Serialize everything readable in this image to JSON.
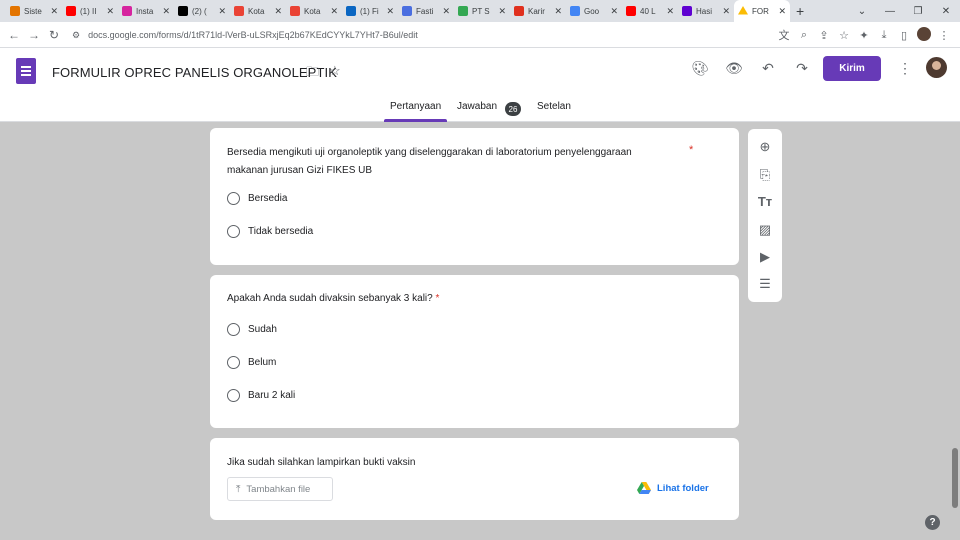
{
  "browser": {
    "tabs": [
      {
        "label": "Siste",
        "color": "#e37400"
      },
      {
        "label": "(1) II",
        "color": "#ff0000"
      },
      {
        "label": "Insta",
        "color": "#d6249f"
      },
      {
        "label": "(2) (",
        "color": "#000000"
      },
      {
        "label": "Kota",
        "color": "#ea4335"
      },
      {
        "label": "Kota",
        "color": "#ea4335"
      },
      {
        "label": "(1) Fi",
        "color": "#0a66c2"
      },
      {
        "label": "Fasti",
        "color": "#4a6ee0"
      },
      {
        "label": "PT S",
        "color": "#34a853"
      },
      {
        "label": "Karir",
        "color": "#e0301e"
      },
      {
        "label": "Goo",
        "color": "#4285f4"
      },
      {
        "label": "40 L",
        "color": "#ff0000"
      },
      {
        "label": "Hasi",
        "color": "#5f01d1"
      },
      {
        "label": "FOR",
        "color": "#fbbc04",
        "active": true
      }
    ],
    "new_tab": "+",
    "url": "docs.google.com/forms/d/1tR71ld-lVerB-uLSRxjEq2b67KEdCYYkL7YHt7-B6ul/edit"
  },
  "header": {
    "title": "FORMULIR OPREC PANELIS ORGANOLEPTIK",
    "send_label": "Kirim",
    "tabs": {
      "questions": "Pertanyaan",
      "responses": "Jawaban",
      "responses_count": "26",
      "settings": "Setelan"
    }
  },
  "questions": [
    {
      "text_line1": "Bersedia mengikuti uji organoleptik yang diselenggarakan di laboratorium penyelenggaraan",
      "text_line2": "makanan jurusan Gizi FIKES UB",
      "required_mark": "*",
      "options": [
        "Bersedia",
        "Tidak bersedia"
      ]
    },
    {
      "text": "Apakah Anda sudah divaksin sebanyak 3 kali?",
      "required_mark": "*",
      "options": [
        "Sudah",
        "Belum",
        "Baru 2 kali"
      ]
    },
    {
      "text": "Jika sudah silahkan lampirkan bukti vaksin",
      "upload_label": "Tambahkan file",
      "folder_link": "Lihat folder"
    }
  ],
  "toolbar": [
    "add-question",
    "import-questions",
    "add-title",
    "add-image",
    "add-video",
    "add-section"
  ],
  "help": "?"
}
